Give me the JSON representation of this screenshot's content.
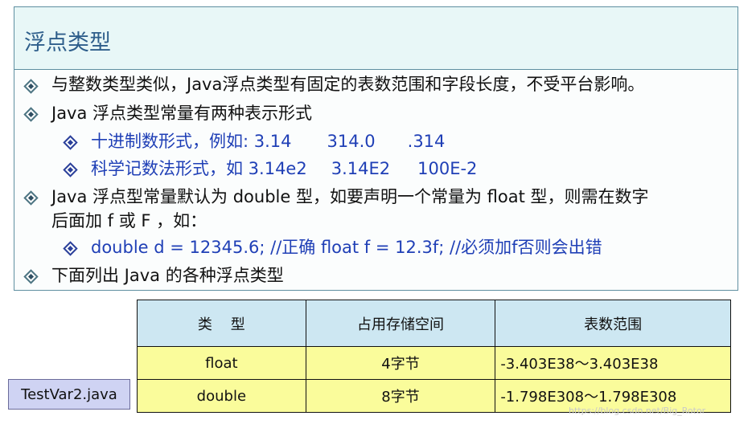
{
  "slide": {
    "title": "浮点类型",
    "bullets": [
      "与整数类型类似，Java浮点类型有固定的表数范围和字段长度，不受平台影响。",
      "Java 浮点类型常量有两种表示形式"
    ],
    "sub_decimal": {
      "label": "十进制数形式，例如: 3.14",
      "v2": "314.0",
      "v3": ".314"
    },
    "sub_scientific": {
      "label": "科学记数法形式，如 3.14e2",
      "v2": "3.14E2",
      "v3": "100E-2"
    },
    "bullet3_line1": "Java 浮点型常量默认为 double 型，如要声明一个常量为 float 型，则需在数字",
    "bullet3_line2": "后面加 f 或 F ，如：",
    "code_example": "double d = 12345.6; //正确   float f = 12.3f; //必须加f否则会出错",
    "bullet4": "下面列出 Java 的各种浮点类型"
  },
  "table": {
    "headers": [
      "类    型",
      "占用存储空间",
      "表数范围"
    ],
    "rows": [
      [
        "float",
        "4字节",
        "-3.403E38～3.403E38"
      ],
      [
        "double",
        "8字节",
        "-1.798E308～1.798E308"
      ]
    ]
  },
  "file_label": "TestVar2.java",
  "watermark": "https://blog.csdn.net/Big_Rotor"
}
